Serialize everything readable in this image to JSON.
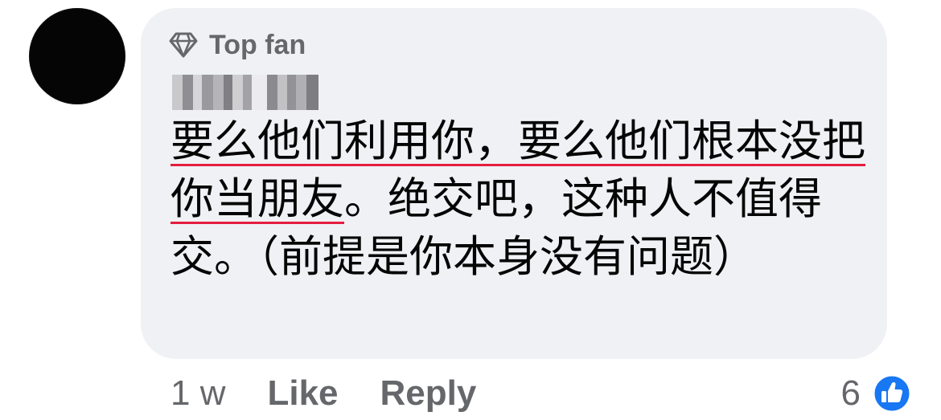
{
  "comment": {
    "badge_label": "Top fan",
    "badge_icon": "diamond-icon",
    "author_name_redacted": true,
    "text_part1": "要么他们利用你，要么他们根本没把你当朋友",
    "text_part2": "。绝交吧，这种人不值得交。（前提是你本身没有问题）"
  },
  "footer": {
    "timestamp": "1 w",
    "like_label": "Like",
    "reply_label": "Reply",
    "reaction_count": "6",
    "reaction_icon": "like-reaction-icon"
  },
  "colors": {
    "bubble_bg": "#f0f1f4",
    "meta_text": "#65676b",
    "body_text": "#050505",
    "like_blue": "#1877f2",
    "spellcheck_underline": "#e41e3f"
  }
}
